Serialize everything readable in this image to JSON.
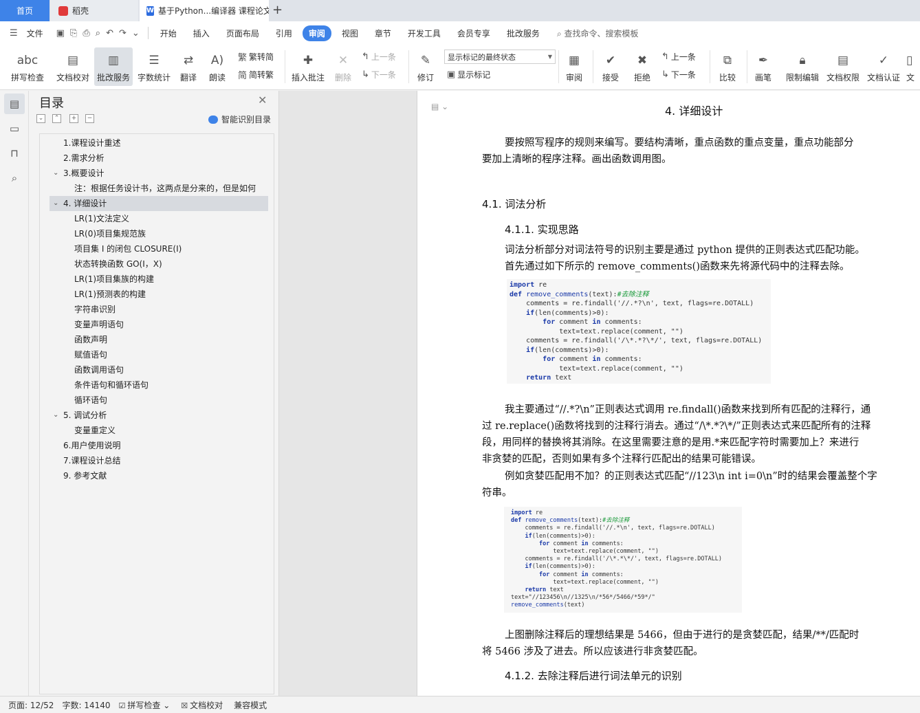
{
  "tabs": {
    "home": "首页",
    "daoke": "稻壳",
    "doc": "基于Python...编译器 课程论文",
    "new_tab": "+"
  },
  "menu": {
    "file": "文件",
    "items": [
      "开始",
      "插入",
      "页面布局",
      "引用",
      "审阅",
      "视图",
      "章节",
      "开发工具",
      "会员专享",
      "批改服务"
    ],
    "active_index": 4,
    "search": "查找命令、搜索模板"
  },
  "ribbon": {
    "spell_check": "拼写检查",
    "doc_proof": "文档校对",
    "correction_service": "批改服务",
    "word_count": "字数统计",
    "translate": "翻译",
    "read_aloud": "朗读",
    "trad_to_simp": "繁转简",
    "simp_to_trad": "简转繁",
    "insert_comment": "插入批注",
    "delete": "删除",
    "prev_comment": "上一条",
    "next_comment": "下一条",
    "revise": "修订",
    "markup_view": "显示标记的最终状态",
    "show_markup": "显示标记",
    "review": "审阅",
    "accept": "接受",
    "reject": "拒绝",
    "prev_change": "上一条",
    "next_change": "下一条",
    "compare": "比较",
    "pen": "画笔",
    "restrict_edit": "限制编辑",
    "doc_permission": "文档权限",
    "doc_cert": "文档认证",
    "doc_more": "文"
  },
  "nav": {
    "title": "目录",
    "ai_toc": "智能识别目录",
    "items": [
      "1.课程设计重述",
      "2.需求分析",
      "3.概要设计",
      "注：根据任务设计书，这两点是分来的，但是如何",
      "4. 详细设计",
      "LR(1)文法定义",
      "LR(0)项目集规范族",
      "项目集 I 的闭包 CLOSURE(I)",
      "状态转换函数 GO(I，X)",
      "LR(1)项目集族的构建",
      "LR(1)预测表的构建",
      "字符串识别",
      "变量声明语句",
      "函数声明",
      "赋值语句",
      "函数调用语句",
      "条件语句和循环语句",
      "循环语句",
      "5. 调试分析",
      "变量重定义",
      "6.用户使用说明",
      "7.课程设计总结",
      "9. 参考文献"
    ]
  },
  "doc": {
    "h4": "4.   详细设计",
    "p1a": "要按照写程序的规则来编写。要结构清晰，重点函数的重点变量，重点功能部分",
    "p1b": "要加上清晰的程序注释。画出函数调用图。",
    "h41": "4.1. 词法分析",
    "h411": "4.1.1.    实现思路",
    "p2a": "词法分析部分对词法符号的识别主要是通过 python 提供的正则表达式匹配功能。",
    "p2b": "首先通过如下所示的 remove_comments()函数来先将源代码中的注释去除。",
    "code1": [
      "import re",
      "def remove_comments(text):#去除注释",
      "    comments = re.findall('//.*?\\n', text, flags=re.DOTALL)",
      "    if(len(comments)>0):",
      "        for comment in comments:",
      "            text=text.replace(comment, \"\")",
      "    comments = re.findall('/\\*.*?\\*/', text, flags=re.DOTALL)",
      "    if(len(comments)>0):",
      "        for comment in comments:",
      "            text=text.replace(comment, \"\")",
      "    return text"
    ],
    "p3a": "我主要通过“//.*?\\n”正则表达式调用 re.findall()函数来找到所有匹配的注释行，通",
    "p3b": "过 re.replace()函数将找到的注释行消去。通过“/\\*.*?\\*/”正则表达式来匹配所有的注释",
    "p3c": "段，用同样的替换将其消除。在这里需要注意的是用.*来匹配字符时需要加上？来进行",
    "p3d": "非贪婪的匹配，否则如果有多个注释行匹配出的结果可能错误。",
    "p4a": "例如贪婪匹配用不加？的正则表达式匹配“//123\\n int i=0\\n”时的结果会覆盖整个字",
    "p4b": "符串。",
    "code2": [
      "import re",
      "def remove_comments(text):#去除注释",
      "    comments = re.findall('//.*\\n', text, flags=re.DOTALL)",
      "    if(len(comments)>0):",
      "        for comment in comments:",
      "            text=text.replace(comment, \"\")",
      "    comments = re.findall('/\\*.*\\*/', text, flags=re.DOTALL)",
      "    if(len(comments)>0):",
      "        for comment in comments:",
      "            text=text.replace(comment, \"\")",
      "    return text",
      "text=\"//123456\\n//1325\\n/*56*/5466/*59*/\"",
      "remove_comments(text)"
    ],
    "p5a": "上图删除注释后的理想结果是 5466，但由于进行的是贪婪匹配，结果/**/匹配时",
    "p5b": "将 5466 涉及了进去。所以应该进行非贪婪匹配。",
    "h412": "4.1.2.    去除注释后进行词法单元的识别"
  },
  "status": {
    "page": "页面: 12/52",
    "words": "字数: 14140",
    "spell": "拼写检查",
    "proof": "文档校对",
    "compat": "兼容模式"
  }
}
